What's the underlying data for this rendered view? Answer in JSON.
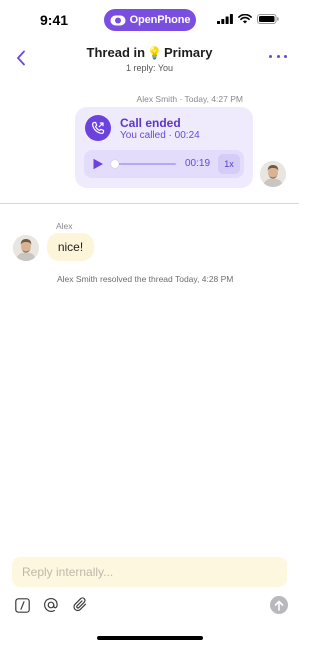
{
  "status_bar": {
    "time": "9:41",
    "brand": "OpenPhone",
    "brand_color": "#7a4fe0",
    "icons": [
      "signal-icon",
      "wifi-icon",
      "battery-icon"
    ]
  },
  "header": {
    "title_prefix": "Thread in",
    "title_emoji": "💡",
    "title_suffix": "Primary",
    "subtitle": "1 reply: You",
    "back_icon": "chevron-left-icon",
    "more_icon": "ellipsis-icon",
    "accent": "#6b47d9"
  },
  "original_message": {
    "meta": "Alex Smith · Today, 4:27 PM",
    "call": {
      "title": "Call ended",
      "subtitle": "You called · 00:24",
      "icon": "phone-outgoing-icon"
    },
    "player": {
      "duration": "00:19",
      "speed": "1x",
      "progress": 0.0,
      "play_icon": "play-icon"
    }
  },
  "reply": {
    "author": "Alex",
    "text": "nice!",
    "resolved_note": "Alex Smith resolved the thread Today, 4:28 PM"
  },
  "composer": {
    "placeholder": "Reply internally...",
    "value": "",
    "tools": [
      "slash-command-icon",
      "mention-icon",
      "attachment-icon"
    ],
    "send_icon": "send-arrow-icon"
  }
}
